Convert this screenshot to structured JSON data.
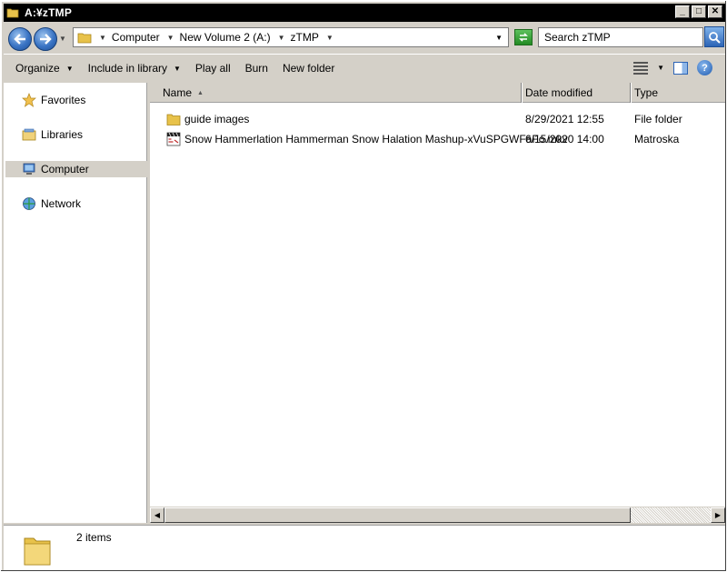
{
  "window": {
    "title": "A:¥zTMP",
    "buttons": {
      "minimize": "_",
      "maximize": "□",
      "close": "✕"
    }
  },
  "address": {
    "breadcrumbs": [
      "Computer",
      "New Volume 2 (A:)",
      "zTMP"
    ],
    "search_placeholder": "Search zTMP"
  },
  "toolbar": {
    "organize": "Organize",
    "include_in_library": "Include in library",
    "play_all": "Play all",
    "burn": "Burn",
    "new_folder": "New folder",
    "help": "?"
  },
  "nav": {
    "items": [
      {
        "label": "Favorites",
        "icon": "star-icon"
      },
      {
        "label": "Libraries",
        "icon": "libraries-icon"
      },
      {
        "label": "Computer",
        "icon": "computer-icon"
      },
      {
        "label": "Network",
        "icon": "network-icon"
      }
    ],
    "selected": "Computer"
  },
  "files": {
    "columns": {
      "name": "Name",
      "date": "Date modified",
      "type": "Type"
    },
    "rows": [
      {
        "name": "guide images",
        "date": "8/29/2021 12:55",
        "type": "File folder",
        "icon": "folder-icon"
      },
      {
        "name": "Snow Hammerlation Hammerman Snow Halation Mashup-xVuSPGWFaFo.mkv",
        "date": "6/15/2020 14:00",
        "type": "Matroska",
        "icon": "mkv-file-icon"
      }
    ]
  },
  "status": {
    "item_count": "2 items"
  },
  "colors": {
    "selection": "#d4d0c8",
    "title_bar": "#000000",
    "frame": "#d4d0c8"
  }
}
